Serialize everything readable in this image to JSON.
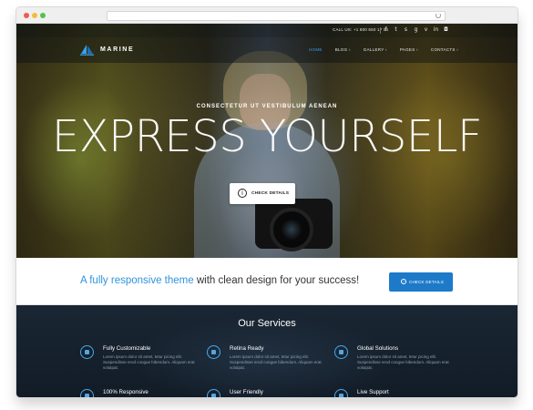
{
  "topbar": {
    "call": "CALL US: +1 800 650 17 04",
    "social_icons": [
      "facebook-icon",
      "twitter-icon",
      "skype-icon",
      "google-plus-icon",
      "vimeo-icon",
      "linkedin-icon",
      "instagram-icon"
    ]
  },
  "brand": {
    "name": "MARINE"
  },
  "nav": {
    "items": [
      {
        "label": "HOME",
        "active": true
      },
      {
        "label": "BLOG"
      },
      {
        "label": "GALLERY"
      },
      {
        "label": "PAGES"
      },
      {
        "label": "CONTACTS"
      }
    ],
    "accent": "#3aa0ea"
  },
  "hero": {
    "kicker": "CONSECTETUR UT VESTIBULUM AENEAN",
    "headline": "EXPRESS YOURSELF",
    "button": "CHECK DETAILS"
  },
  "promo": {
    "highlight": "A fully responsive theme",
    "rest": " with clean design for your success!",
    "button": "CHECK DETAILS",
    "button_color": "#1d7ac9"
  },
  "services": {
    "title": "Our Services",
    "items": [
      {
        "title": "Fully Customizable",
        "desc": "Lorem ipsum dolor sit amet, tetur picing elit. Suspendisse erod congue bibendum. Aliquam erat volutpat."
      },
      {
        "title": "Retina Ready",
        "desc": "Lorem ipsum dolor sit amet, tetur picing elit. Suspendisse erod congue bibendum. Aliquam erat volutpat."
      },
      {
        "title": "Global Solutions",
        "desc": "Lorem ipsum dolor sit amet, tetur picing elit. Suspendisse erod congue bibendum. Aliquam erat volutpat."
      },
      {
        "title": "100% Responsive",
        "desc": ""
      },
      {
        "title": "User Friendly",
        "desc": ""
      },
      {
        "title": "Live Support",
        "desc": ""
      }
    ]
  }
}
